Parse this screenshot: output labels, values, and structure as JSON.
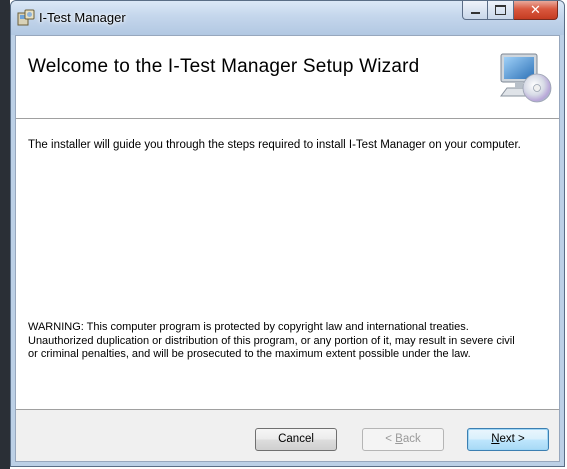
{
  "window": {
    "title": "I-Test Manager",
    "icons": {
      "app": "installer-icon",
      "minimize": "minimize-icon",
      "maximize": "maximize-icon",
      "close": "close-icon"
    }
  },
  "banner": {
    "title": "Welcome to the I-Test Manager Setup Wizard",
    "icon": "computer-cd-icon"
  },
  "body": {
    "intro": "The installer will guide you through the steps required to install I-Test Manager on your computer.",
    "warning_lines": [
      "WARNING: This computer program is protected by copyright law and international treaties.",
      "Unauthorized duplication or distribution of this program, or any portion of it, may result in severe civil",
      "or criminal penalties, and will be prosecuted to the maximum extent possible under the law."
    ]
  },
  "buttons": {
    "cancel": "Cancel",
    "back_accel": "B",
    "back_rest": "ack",
    "back_prefix": "< ",
    "next_accel": "N",
    "next_rest": "ext >"
  },
  "colors": {
    "titlebar": "#c4d6ec",
    "close_button": "#d9583f",
    "default_button_border": "#3c7fb1",
    "disabled_text": "#9a9a9a"
  }
}
